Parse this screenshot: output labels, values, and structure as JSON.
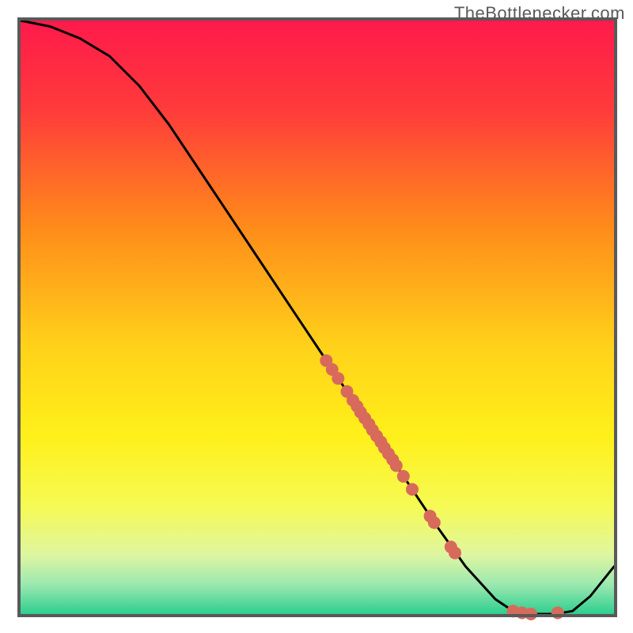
{
  "watermark": "TheBottlenecker.com",
  "chart_data": {
    "type": "line",
    "title": "",
    "xlabel": "",
    "ylabel": "",
    "xlim": [
      0,
      100
    ],
    "ylim": [
      0,
      100
    ],
    "curve": [
      {
        "x": 0,
        "y": 100
      },
      {
        "x": 5,
        "y": 99
      },
      {
        "x": 10,
        "y": 97
      },
      {
        "x": 15,
        "y": 94
      },
      {
        "x": 20,
        "y": 89
      },
      {
        "x": 25,
        "y": 82.5
      },
      {
        "x": 30,
        "y": 75
      },
      {
        "x": 35,
        "y": 67.5
      },
      {
        "x": 40,
        "y": 60
      },
      {
        "x": 45,
        "y": 52.5
      },
      {
        "x": 50,
        "y": 45
      },
      {
        "x": 55,
        "y": 37.5
      },
      {
        "x": 60,
        "y": 30
      },
      {
        "x": 65,
        "y": 22.5
      },
      {
        "x": 70,
        "y": 15
      },
      {
        "x": 75,
        "y": 8
      },
      {
        "x": 80,
        "y": 2.5
      },
      {
        "x": 83,
        "y": 0.5
      },
      {
        "x": 86,
        "y": 0
      },
      {
        "x": 90,
        "y": 0
      },
      {
        "x": 93,
        "y": 0.5
      },
      {
        "x": 96,
        "y": 3
      },
      {
        "x": 100,
        "y": 8
      }
    ],
    "clusters": [
      {
        "x": 51.5,
        "y": 42.7
      },
      {
        "x": 52.5,
        "y": 41.2
      },
      {
        "x": 53.5,
        "y": 39.7
      },
      {
        "x": 55.0,
        "y": 37.5
      },
      {
        "x": 56.0,
        "y": 36.0
      },
      {
        "x": 56.7,
        "y": 35.0
      },
      {
        "x": 57.3,
        "y": 34.0
      },
      {
        "x": 58.0,
        "y": 33.0
      },
      {
        "x": 58.7,
        "y": 32.0
      },
      {
        "x": 59.3,
        "y": 31.0
      },
      {
        "x": 60.0,
        "y": 30.0
      },
      {
        "x": 60.7,
        "y": 29.0
      },
      {
        "x": 61.3,
        "y": 28.0
      },
      {
        "x": 62.0,
        "y": 27.0
      },
      {
        "x": 62.7,
        "y": 26.0
      },
      {
        "x": 63.3,
        "y": 25.0
      },
      {
        "x": 64.5,
        "y": 23.2
      },
      {
        "x": 66.0,
        "y": 21.0
      },
      {
        "x": 69.0,
        "y": 16.5
      },
      {
        "x": 69.7,
        "y": 15.4
      },
      {
        "x": 72.5,
        "y": 11.3
      },
      {
        "x": 73.2,
        "y": 10.3
      },
      {
        "x": 83.0,
        "y": 0.5
      },
      {
        "x": 84.5,
        "y": 0.2
      },
      {
        "x": 86.0,
        "y": 0.0
      },
      {
        "x": 90.5,
        "y": 0.2
      }
    ],
    "gradient_stops": [
      {
        "offset": 0.0,
        "color": "#FF1A4B"
      },
      {
        "offset": 0.15,
        "color": "#FF3B3B"
      },
      {
        "offset": 0.35,
        "color": "#FF8C1A"
      },
      {
        "offset": 0.55,
        "color": "#FFD21A"
      },
      {
        "offset": 0.7,
        "color": "#FFF01A"
      },
      {
        "offset": 0.82,
        "color": "#F5FA55"
      },
      {
        "offset": 0.9,
        "color": "#DFF6A0"
      },
      {
        "offset": 0.95,
        "color": "#9CE8B0"
      },
      {
        "offset": 1.0,
        "color": "#2ECF8F"
      }
    ],
    "dot_color": "#D86A5C",
    "curve_color": "#000000",
    "frame_color": "#595959"
  }
}
